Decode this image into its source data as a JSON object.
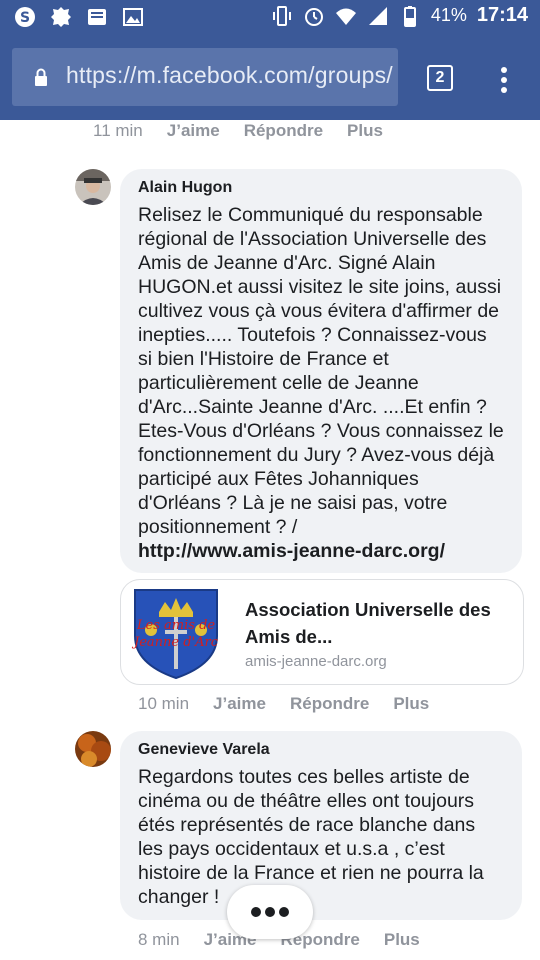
{
  "statusbar": {
    "battery": "41%",
    "time": "17:14"
  },
  "browser": {
    "url": "https://m.facebook.com/groups/",
    "tab_count": "2"
  },
  "comments": [
    {
      "actions": {
        "time": "11 min",
        "like": "J’aime",
        "reply": "Répondre",
        "more": "Plus"
      }
    },
    {
      "author": "Alain Hugon",
      "text": "Relisez le Communiqué du responsable régional de l'Association Universelle des Amis de Jeanne d'Arc. Signé Alain HUGON.et aussi visitez le site joins, aussi cultivez vous çà vous évitera d'affirmer de inepties..... Toutefois ? Connaissez-vous si bien l'Histoire de France et particulièrement celle de Jeanne d'Arc...Sainte Jeanne d'Arc. ....Et enfin ? Etes-Vous d'Orléans ? Vous connaissez le fonctionnement du Jury ? Avez-vous déjà participé aux Fêtes Johanniques d'Orléans ? Là je ne saisi pas, votre positionnement ? /",
      "link": "http://www.amis-jeanne-darc.org/",
      "link_preview": {
        "title": "Association Universelle des Amis de...",
        "domain": "amis-jeanne-darc.org",
        "thumb_text": "Les amis de Jeanne d'Arc"
      },
      "actions": {
        "time": "10 min",
        "like": "J’aime",
        "reply": "Répondre",
        "more": "Plus"
      }
    },
    {
      "author": "Genevieve Varela",
      "text": "Regardons toutes ces belles artiste de cinéma ou de théâtre elles ont toujours étés représentés de race blanche dans les pays occidentaux et u.s.a , c’est histoire de la France et rien ne pourra la changer !",
      "actions": {
        "time": "8 min",
        "like": "J’aime",
        "reply": "Répondre",
        "more": "Plus"
      }
    }
  ],
  "colors": {
    "brand": "#3b5998",
    "bubble": "#f0f2f5",
    "meta": "#90949c"
  }
}
